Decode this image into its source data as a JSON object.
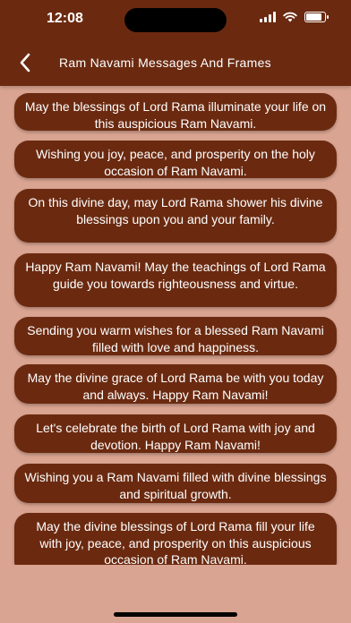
{
  "status_bar": {
    "time": "12:08"
  },
  "nav": {
    "title": "Ram Navami Messages And Frames"
  },
  "messages": [
    "May the blessings of Lord Rama illuminate your life on this auspicious Ram Navami.",
    "Wishing you joy, peace, and prosperity on the holy occasion of Ram Navami.",
    "On this divine day, may Lord Rama shower his divine blessings upon you and your family.",
    "Happy Ram Navami! May the teachings of Lord Rama guide you towards righteousness and virtue.",
    "Sending you warm wishes for a blessed Ram Navami filled with love and happiness.",
    "May the divine grace of Lord Rama be with you today and always. Happy Ram Navami!",
    "Let's celebrate the birth of Lord Rama with joy and devotion. Happy Ram Navami!",
    "Wishing you a Ram Navami filled with divine blessings and spiritual growth.",
    "May the divine blessings of Lord Rama fill your life with joy, peace, and prosperity on this auspicious occasion of Ram Navami."
  ],
  "colors": {
    "accent": "#6b2a10",
    "background": "#d9a491",
    "text": "#ffffff"
  }
}
